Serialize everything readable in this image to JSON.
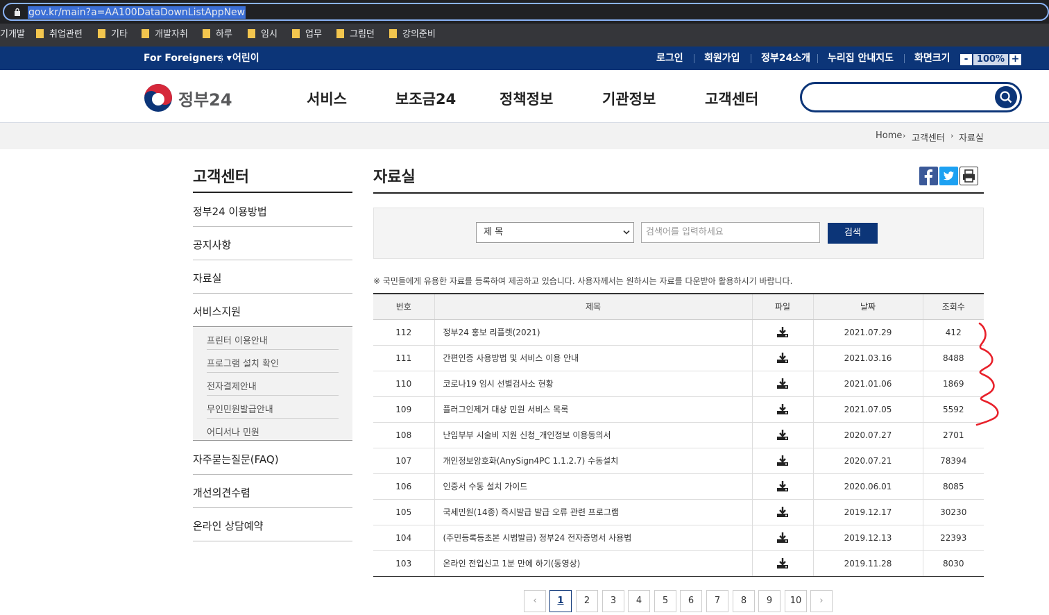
{
  "browser": {
    "url": "gov.kr/main?a=AA100DataDownListAppNew",
    "bookmarks": [
      "기개발",
      "취업관련",
      "기타",
      "개발자취",
      "하루",
      "임시",
      "업무",
      "그림던",
      "강의준비"
    ]
  },
  "topnav": {
    "foreigners": "For Foreigners ▾",
    "kids": "어린이",
    "login": "로그인",
    "join": "회원가입",
    "about": "정부24소개",
    "sitemap": "누리집 안내지도",
    "zoom_label": "화면크기",
    "zoom_minus": "-",
    "zoom_value": "100%",
    "zoom_plus": "+"
  },
  "header": {
    "logo": "정부24",
    "menu": [
      "서비스",
      "보조금24",
      "정책정보",
      "기관정보",
      "고객센터"
    ]
  },
  "breadcrumb": [
    "Home",
    "고객센터",
    "자료실"
  ],
  "lnb": {
    "title": "고객센터",
    "items": [
      "정부24 이용방법",
      "공지사항",
      "자료실",
      "서비스지원",
      "자주묻는질문(FAQ)",
      "개선의견수렴",
      "온라인 상담예약"
    ],
    "subitems": [
      "프린터 이용안내",
      "프로그램 설치 확인",
      "전자결제안내",
      "무인민원발급안내",
      "어디서나 민원"
    ]
  },
  "main": {
    "title": "자료실",
    "search": {
      "select_value": "제 목",
      "placeholder": "검색어를 입력하세요",
      "button": "검색"
    },
    "notice": "※ 국민들에게 유용한 자료를 등록하여 제공하고 있습니다. 사용자께서는 원하시는 자료를 다운받아 활용하시기 바랍니다.",
    "table": {
      "headers": [
        "번호",
        "제목",
        "파일",
        "날짜",
        "조회수"
      ],
      "rows": [
        {
          "no": "112",
          "title": "정부24 홍보 리플렛(2021)",
          "date": "2021.07.29",
          "views": "412"
        },
        {
          "no": "111",
          "title": "간편인증 사용방법 및 서비스 이용 안내",
          "date": "2021.03.16",
          "views": "8488"
        },
        {
          "no": "110",
          "title": "코로나19 임시 선별검사소 현황",
          "date": "2021.01.06",
          "views": "1869"
        },
        {
          "no": "109",
          "title": "플러그인제거 대상 민원 서비스 목록",
          "date": "2021.07.05",
          "views": "5592"
        },
        {
          "no": "108",
          "title": "난임부부 시술비 지원 신청_개인정보 이용동의서",
          "date": "2020.07.27",
          "views": "2701"
        },
        {
          "no": "107",
          "title": "개인정보암호화(AnySign4PC 1.1.2.7) 수동설치",
          "date": "2020.07.21",
          "views": "78394"
        },
        {
          "no": "106",
          "title": "인증서 수동 설치 가이드",
          "date": "2020.06.01",
          "views": "8085"
        },
        {
          "no": "105",
          "title": "국세민원(14종) 즉시발급 발급 오류 관련 프로그램",
          "date": "2019.12.17",
          "views": "30230"
        },
        {
          "no": "104",
          "title": "(주민등록등초본 시범발급) 정부24 전자증명서 사용법",
          "date": "2019.12.13",
          "views": "22393"
        },
        {
          "no": "103",
          "title": "온라인 전입신고 1분 만에 하기(동영상)",
          "date": "2019.11.28",
          "views": "8030"
        }
      ]
    },
    "pagination": {
      "prev": "‹",
      "pages": [
        "1",
        "2",
        "3",
        "4",
        "5",
        "6",
        "7",
        "8",
        "9",
        "10"
      ],
      "next": "›",
      "current": "1"
    }
  },
  "colors": {
    "navy": "#0c3578",
    "annotation_red": "#e8202a"
  }
}
